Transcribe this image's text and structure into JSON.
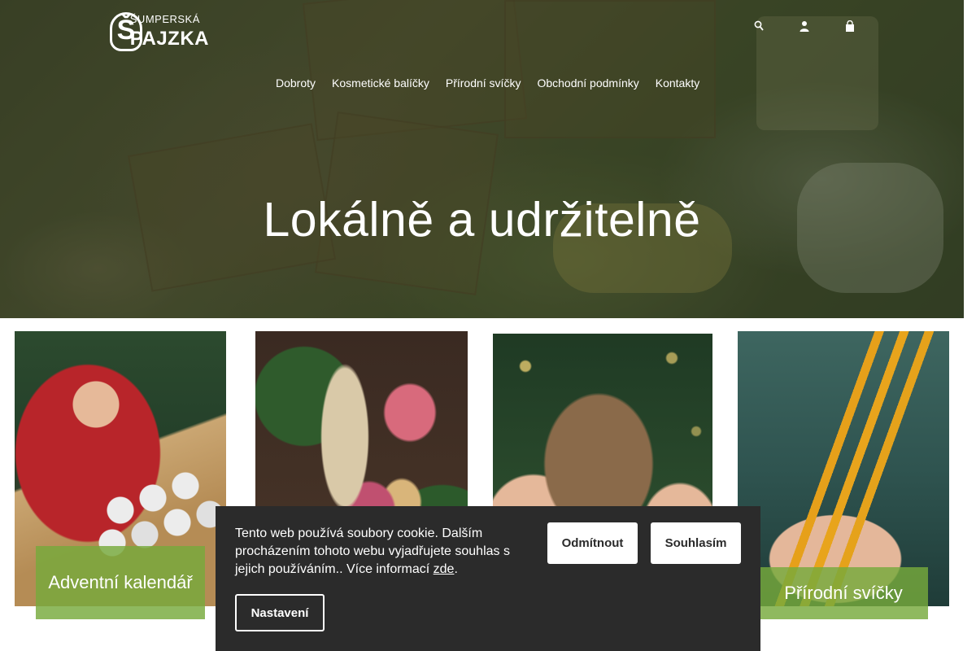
{
  "brand": {
    "top": "ŠUMPERSKÁ",
    "bottom": "PAJZKA",
    "mark": "Š"
  },
  "header_icons": [
    "search-icon",
    "user-icon",
    "cart-icon"
  ],
  "nav": {
    "items": [
      {
        "label": "Dobroty"
      },
      {
        "label": "Kosmetické balíčky"
      },
      {
        "label": "Přírodní svíčky"
      },
      {
        "label": "Obchodní podmínky"
      },
      {
        "label": "Kontakty"
      }
    ]
  },
  "hero": {
    "title": "Lokálně a udržitelně"
  },
  "cards": [
    {
      "label": "Adventní kalendář"
    },
    {
      "label": ""
    },
    {
      "label": ""
    },
    {
      "label": "Přírodní svíčky"
    }
  ],
  "cookie": {
    "text": "Tento web používá soubory cookie. Dalším procházením tohoto webu vyjadřujete souhlas s jejich používáním.. Více informací ",
    "link": "zde",
    "after_link": ".",
    "decline": "Odmítnout",
    "accept": "Souhlasím",
    "settings": "Nastavení"
  },
  "colors": {
    "label_green": "#76aa3c",
    "cookie_bg": "#2b2b2b"
  }
}
